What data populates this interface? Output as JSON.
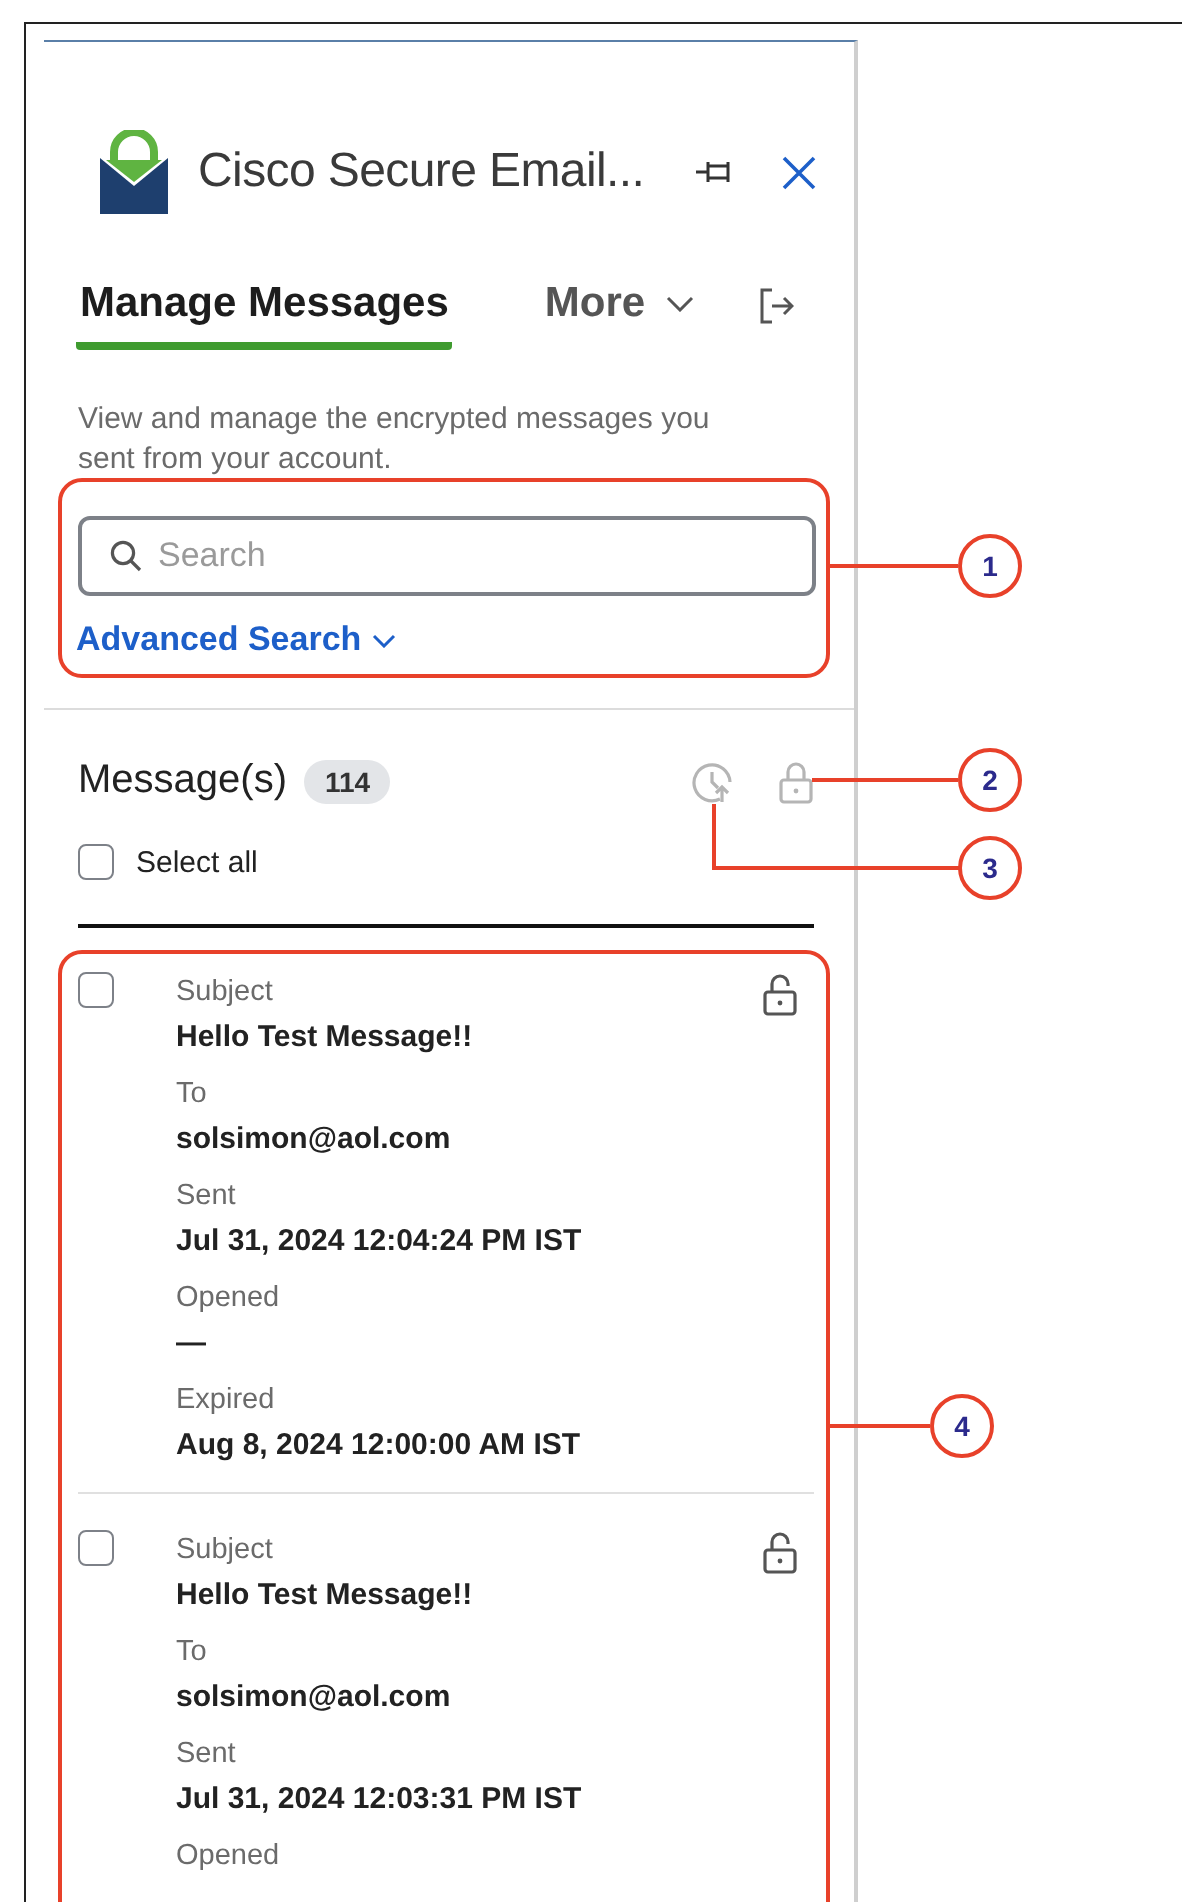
{
  "header": {
    "title": "Cisco Secure Email..."
  },
  "tabs": [
    {
      "label": "Manage Messages",
      "selected": true
    },
    {
      "label": "More",
      "selected": false
    }
  ],
  "description": "View and manage the encrypted messages you sent from your account.",
  "search": {
    "placeholder": "Search"
  },
  "advanced_search": "Advanced Search",
  "messages_header": {
    "title": "Message(s)",
    "count": "114"
  },
  "select_all": {
    "label": "Select all",
    "checked": false
  },
  "messages": [
    {
      "checked": false,
      "locked": false,
      "fields": [
        {
          "label": "Subject",
          "value": "Hello Test Message!!"
        },
        {
          "label": "To",
          "value": "solsimon@aol.com"
        },
        {
          "label": "Sent",
          "value": "Jul 31, 2024 12:04:24 PM IST"
        },
        {
          "label": "Opened",
          "value": "—"
        },
        {
          "label": "Expired",
          "value": "Aug 8, 2024 12:00:00 AM IST"
        }
      ]
    },
    {
      "checked": false,
      "locked": false,
      "fields": [
        {
          "label": "Subject",
          "value": "Hello Test Message!!"
        },
        {
          "label": "To",
          "value": "solsimon@aol.com"
        },
        {
          "label": "Sent",
          "value": "Jul 31, 2024 12:03:31 PM IST"
        },
        {
          "label": "Opened"
        }
      ]
    }
  ],
  "callouts": [
    {
      "number": "1"
    },
    {
      "number": "2"
    },
    {
      "number": "3"
    },
    {
      "number": "4"
    }
  ]
}
